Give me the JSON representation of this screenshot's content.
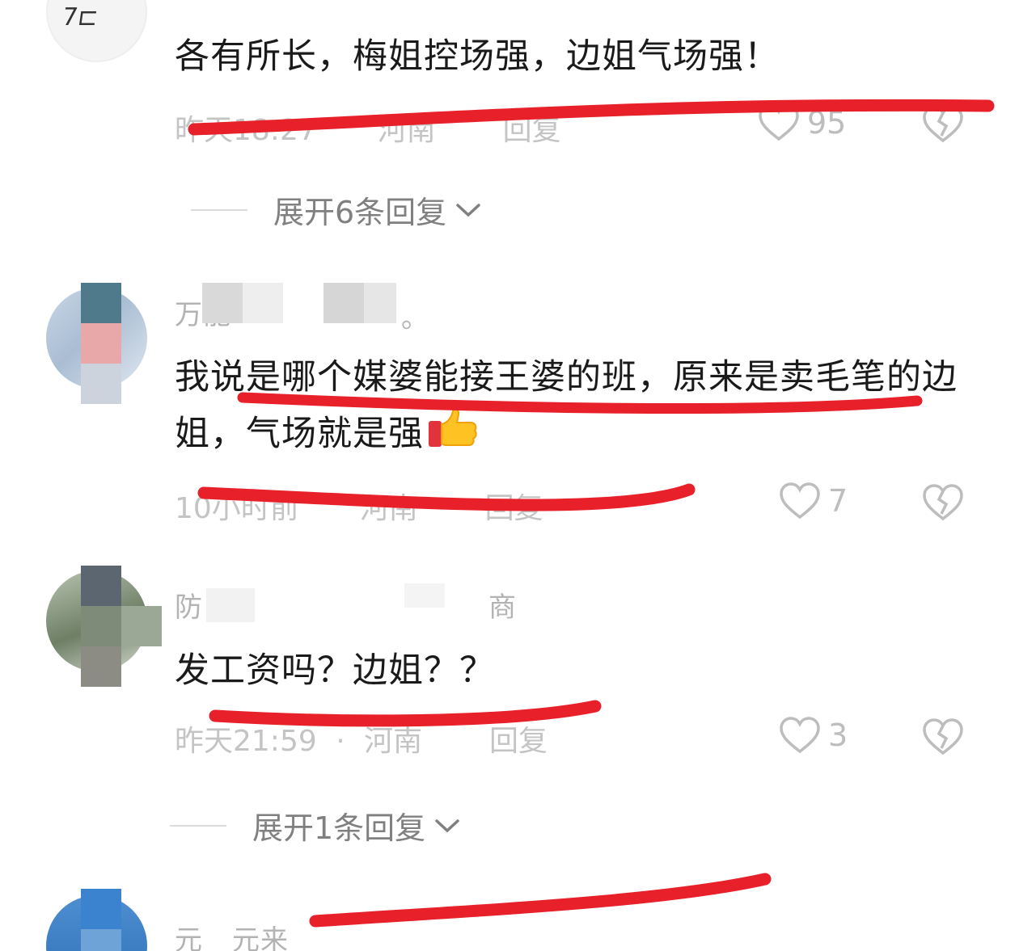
{
  "comments": [
    {
      "name": "",
      "text": "各有所长，梅姐控场强，边姐气场强！",
      "time": "昨天18:27",
      "location": "河南",
      "reply_label": "回复",
      "likes": "95"
    },
    {
      "name": "万能",
      "name_suffix": "。",
      "text": "我说是哪个媒婆能接王婆的班，原来是卖毛笔的边姐，气场就是强",
      "time": "10小时前",
      "location": "河南",
      "reply_label": "回复",
      "likes": "7"
    },
    {
      "name": "防",
      "name_suffix": "商",
      "text": "发工资吗？边姐？？",
      "time": "昨天21:59",
      "separator": "·",
      "location": "河南",
      "reply_label": "回复",
      "likes": "3"
    },
    {
      "name": "元",
      "name_suffix": "元来"
    }
  ],
  "expand_replies": [
    {
      "label": "展开6条回复"
    },
    {
      "label": "展开1条回复"
    }
  ],
  "icons": {
    "like": "heart-outline-icon",
    "dislike": "broken-heart-icon",
    "expand": "chevron-down-icon",
    "emoji": "thumbs-up-emoji"
  },
  "colors": {
    "annotation_red": "#e8202a",
    "meta_gray": "#c4c4c4",
    "text_dark": "#1a1a1a"
  }
}
